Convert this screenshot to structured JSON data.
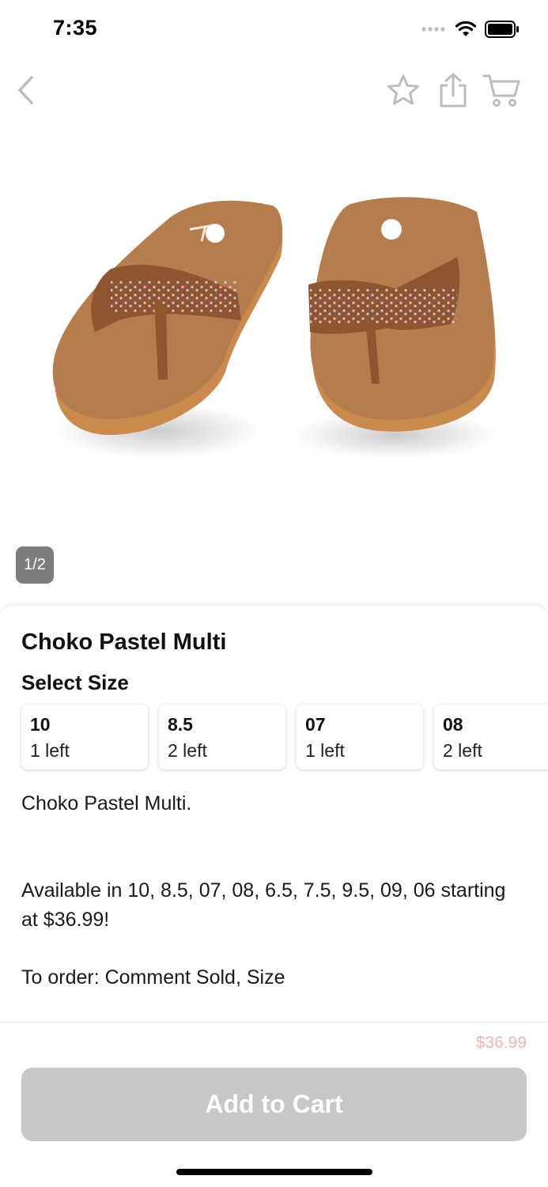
{
  "status_bar": {
    "time": "7:35"
  },
  "nav": {
    "back_icon": "chevron-left-icon",
    "favorite_icon": "star-icon",
    "share_icon": "share-icon",
    "cart_icon": "cart-icon"
  },
  "gallery": {
    "page_indicator": "1/2",
    "current_page": 1,
    "total_pages": 2
  },
  "product": {
    "title": "Choko Pastel Multi",
    "size_heading": "Select Size",
    "sizes": [
      {
        "value": "10",
        "stock": "1 left"
      },
      {
        "value": "8.5",
        "stock": "2 left"
      },
      {
        "value": "07",
        "stock": "1 left"
      },
      {
        "value": "08",
        "stock": "2 left"
      }
    ],
    "description": [
      "Choko Pastel Multi.",
      "",
      "Available in 10, 8.5, 07, 08, 6.5, 7.5, 9.5, 09, 06 starting at $36.99!",
      "To order: Comment Sold, Size"
    ]
  },
  "footer": {
    "price": "$36.99",
    "add_to_cart": "Add to Cart"
  },
  "colors": {
    "price": "#f4b3b3",
    "button_disabled": "#c7c7c7",
    "indicator_bg": "#7d7d7d",
    "sandal": "#b87a44"
  }
}
